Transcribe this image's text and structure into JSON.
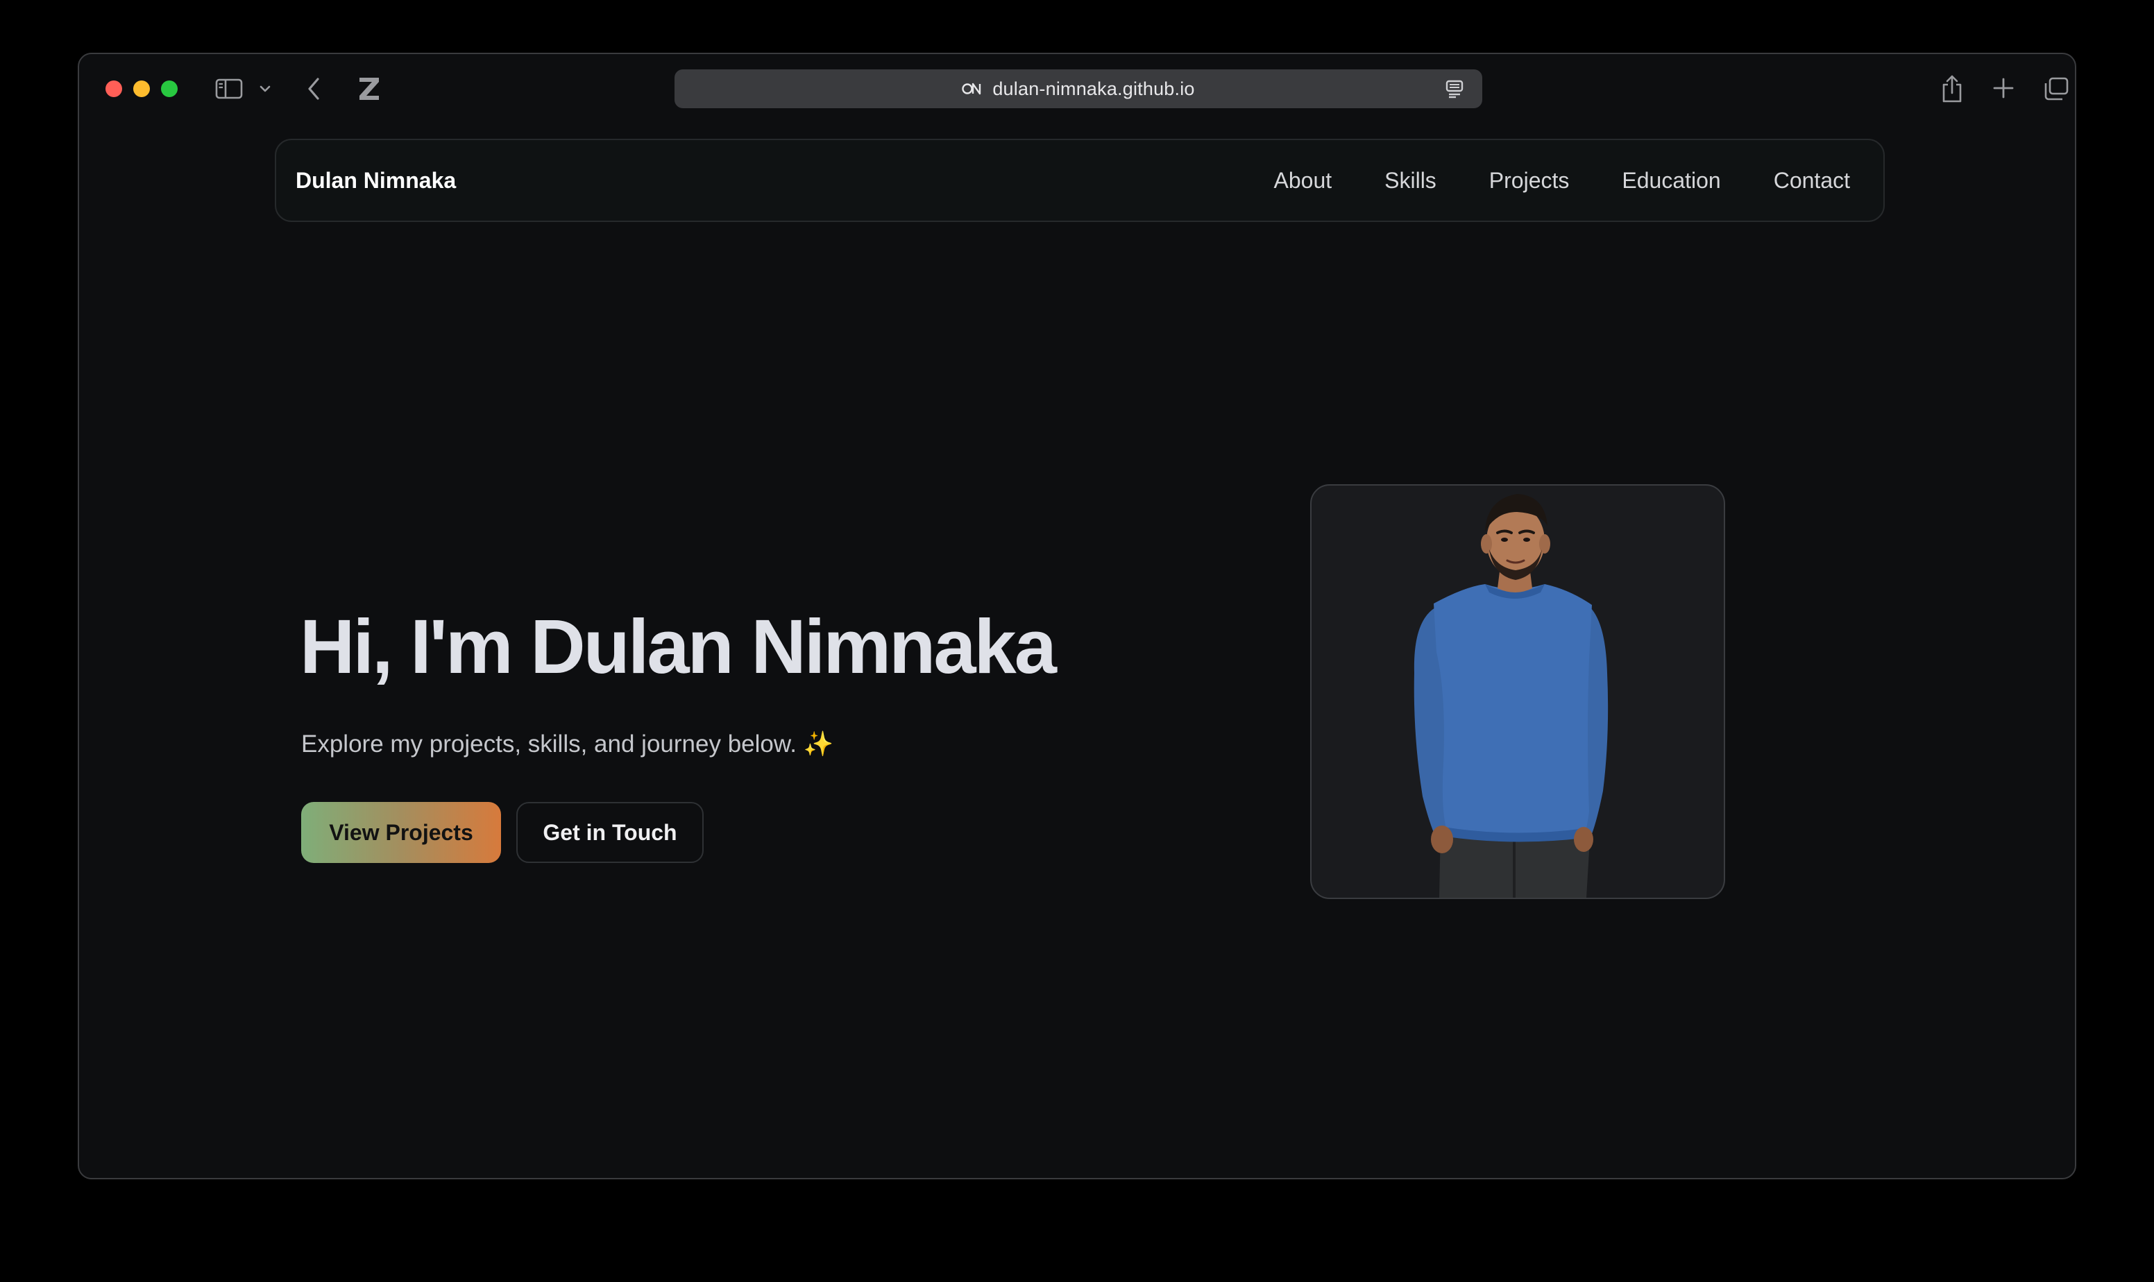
{
  "browser": {
    "url": "dulan-nimnaka.github.io",
    "icons": [
      "sidebar-icon",
      "chevron-down-icon",
      "back-icon",
      "zed-logo-icon",
      "site-settings-icon",
      "reader-icon",
      "share-icon",
      "new-tab-icon",
      "tabs-overview-icon"
    ],
    "traffic_light_colors": [
      "#ff5f57",
      "#febc2e",
      "#28c840"
    ]
  },
  "nav": {
    "brand": "Dulan Nimnaka",
    "links": [
      "About",
      "Skills",
      "Projects",
      "Education",
      "Contact"
    ]
  },
  "hero": {
    "title": "Hi, I'm Dulan Nimnaka",
    "subtitle": "Explore my projects, skills, and journey below. ✨",
    "primary_button": "View Projects",
    "secondary_button": "Get in Touch"
  },
  "colors": {
    "page_bg": "#0d0e10",
    "button_gradient": [
      "#7fae79",
      "#d77a3c"
    ],
    "shirt": "#3f6fb5"
  }
}
